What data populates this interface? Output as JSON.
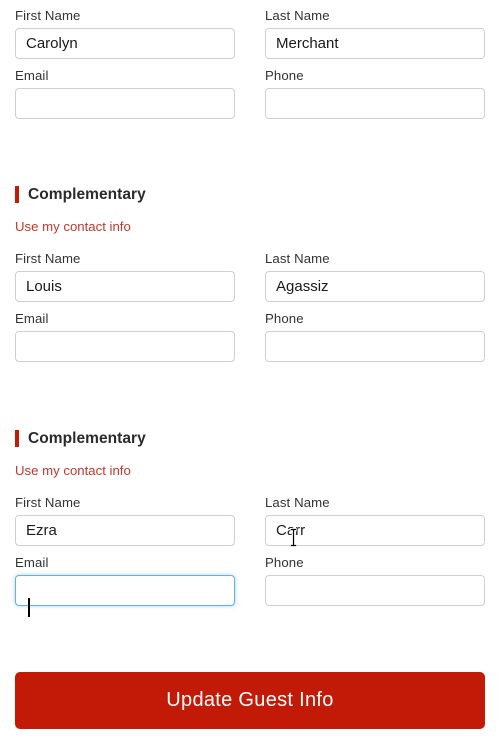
{
  "form": {
    "labels": {
      "first_name": "First Name",
      "last_name": "Last Name",
      "email": "Email",
      "phone": "Phone"
    },
    "guests": [
      {
        "section_title": null,
        "use_contact_link": null,
        "first_name": "Carolyn",
        "last_name": "Merchant",
        "email": "",
        "phone": ""
      },
      {
        "section_title": "Complementary",
        "use_contact_link": "Use my contact info",
        "first_name": "Louis",
        "last_name": "Agassiz",
        "email": "",
        "phone": ""
      },
      {
        "section_title": "Complementary",
        "use_contact_link": "Use my contact info",
        "first_name": "Ezra",
        "last_name": "Carr",
        "email": "",
        "phone": ""
      }
    ],
    "submit_label": "Update Guest Info"
  },
  "colors": {
    "accent_red": "#c41b06",
    "button_red": "#c21a06",
    "link_red": "#c5372c",
    "focus_blue": "#66afe9",
    "input_border": "#cfcfcf",
    "label_text": "#333333"
  },
  "state": {
    "focused_field": "guest-3-email",
    "cursor_over_field": "guest-3-last-name"
  }
}
